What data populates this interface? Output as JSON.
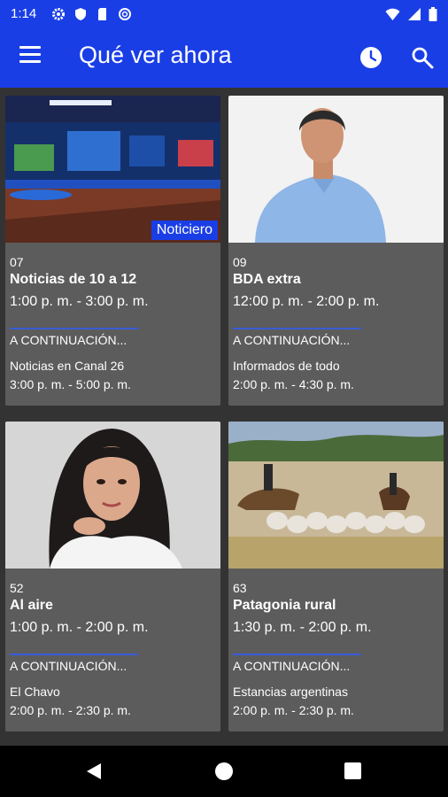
{
  "status_bar": {
    "time": "1:14",
    "icons": [
      "settings-icon",
      "shield-icon",
      "sim-card-icon",
      "no-disturb-icon",
      "wifi-icon",
      "signal-icon",
      "battery-icon"
    ]
  },
  "app_bar": {
    "title": "Qué ver ahora",
    "icons": [
      "menu-icon",
      "clock-icon",
      "search-icon"
    ]
  },
  "colors": {
    "primary": "#1a3ee6",
    "card_bg": "#5c5c5c",
    "page_bg": "#333333",
    "divider": "#3a5bd8"
  },
  "cards": [
    {
      "channel": "07",
      "title": "Noticias de 10 a 12",
      "time": "1:00 p. m. - 3:00 p. m.",
      "badge": "Noticiero",
      "next_label": "A CONTINUACIÓN...",
      "next_title": "Noticias en Canal 26",
      "next_time": "3:00 p. m. - 5:00 p. m."
    },
    {
      "channel": "09",
      "title": "BDA extra",
      "time": "12:00 p. m. - 2:00 p. m.",
      "next_label": "A CONTINUACIÓN...",
      "next_title": "Informados de todo",
      "next_time": "2:00 p. m. - 4:30 p. m."
    },
    {
      "channel": "52",
      "title": "Al aire",
      "time": "1:00 p. m. - 2:00 p. m.",
      "next_label": "A CONTINUACIÓN...",
      "next_title": "El Chavo",
      "next_time": "2:00 p. m. - 2:30 p. m."
    },
    {
      "channel": "63",
      "title": "Patagonia rural",
      "time": "1:30 p. m. - 2:00 p. m.",
      "next_label": "A CONTINUACIÓN...",
      "next_title": "Estancias argentinas",
      "next_time": "2:00 p. m. - 2:30 p. m."
    }
  ],
  "nav_bar": {
    "icons": [
      "back-icon",
      "home-icon",
      "recents-icon"
    ]
  }
}
